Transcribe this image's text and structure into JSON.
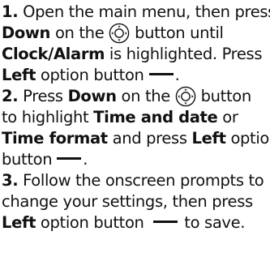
{
  "steps": [
    {
      "number": "1.",
      "t1": "Open the main menu, then press",
      "k1": "Down",
      "t2": "on the",
      "t3": "button until",
      "k2": "Clock/Alarm",
      "t4": "is highlighted. Press",
      "k3": "Left",
      "t5": "option button",
      "t6": "."
    },
    {
      "number": "2.",
      "t1": "Press",
      "k1": "Down",
      "t2": "on the",
      "t3": "button",
      "t4": "to highlight",
      "k2": "Time and date",
      "t5": "or",
      "k3": "Time format",
      "t6": "and press",
      "k4": "Left",
      "t7": "option",
      "t8": "button",
      "t9": "."
    },
    {
      "number": "3.",
      "t1": "Follow the onscreen prompts to",
      "t2": "change your settings, then press",
      "k1": "Left",
      "t3": "option button",
      "t4": "to save."
    }
  ],
  "icons": {
    "nav": "nav-key-icon",
    "option": "option-button-icon"
  },
  "colors": {
    "text": "#111111",
    "background": "#ffffff"
  }
}
